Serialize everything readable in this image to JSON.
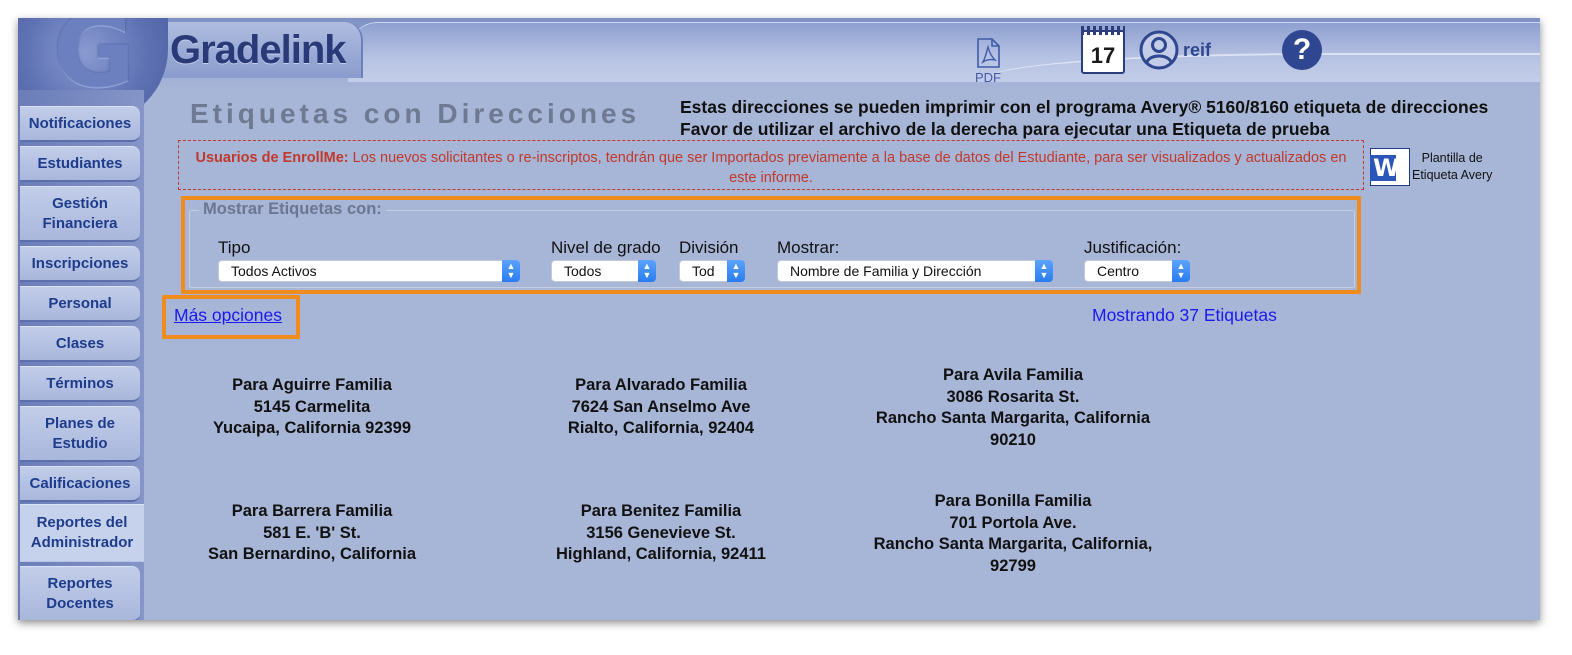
{
  "header": {
    "brand": "Gradelink",
    "logo_letter": "G",
    "pdf_label": "PDF",
    "calendar_day": "17",
    "user_name": "reif",
    "help_symbol": "?"
  },
  "sidebar": {
    "items": [
      {
        "label": "Notificaciones"
      },
      {
        "label": "Estudiantes"
      },
      {
        "label": "Gestión Financiera"
      },
      {
        "label": "Inscripciones"
      },
      {
        "label": "Personal"
      },
      {
        "label": "Clases"
      },
      {
        "label": "Términos"
      },
      {
        "label": "Planes de Estudio"
      },
      {
        "label": "Calificaciones"
      },
      {
        "label": "Reportes del Administrador"
      },
      {
        "label": "Reportes Docentes"
      }
    ]
  },
  "page": {
    "title": "Etiquetas con Direcciones",
    "avery_line1": "Estas direcciones se pueden imprimir con el programa Avery® 5160/8160 etiqueta de direcciones",
    "avery_line2": "Favor de utilizar el archivo de la derecha para ejecutar una Etiqueta de prueba",
    "notice_bold": "Usuarios de EnrollMe:",
    "notice_text": " Los nuevos solicitantes o re-inscriptos, tendrán que ser Importados previamente a la base de datos del Estudiante, para ser visualizados y actualizados en este informe.",
    "word_template_line1": "Plantilla de",
    "word_template_line2": "Etiqueta Avery"
  },
  "filters": {
    "legend": "Mostrar Etiquetas con:",
    "tipo": {
      "label": "Tipo",
      "value": "Todos Activos"
    },
    "nivel": {
      "label": "Nivel de grado",
      "value": "Todos"
    },
    "division": {
      "label": "División",
      "value": "Tod"
    },
    "mostrar": {
      "label": "Mostrar:",
      "value": "Nombre de Familia y Dirección"
    },
    "justificacion": {
      "label": "Justificación:",
      "value": "Centro"
    }
  },
  "more_options": "Más opciones",
  "label_count": "Mostrando 37 Etiquetas",
  "labels": [
    {
      "name": "Para Aguirre Familia",
      "street": "5145 Carmelita",
      "city": "Yucaipa, California 92399",
      "zip": ""
    },
    {
      "name": "Para Alvarado Familia",
      "street": "7624 San Anselmo Ave",
      "city": "Rialto, California, 92404",
      "zip": ""
    },
    {
      "name": "Para Avila Familia",
      "street": "3086 Rosarita St.",
      "city": "Rancho Santa Margarita, California",
      "zip": "90210"
    },
    {
      "name": "Para Barrera Familia",
      "street": "581 E. 'B' St.",
      "city": "San Bernardino, California",
      "zip": ""
    },
    {
      "name": "Para Benitez Familia",
      "street": "3156 Genevieve St.",
      "city": "Highland, California, 92411",
      "zip": ""
    },
    {
      "name": "Para Bonilla Familia",
      "street": "701 Portola Ave.",
      "city": "Rancho Santa Margarita, California,",
      "zip": "92799"
    }
  ]
}
